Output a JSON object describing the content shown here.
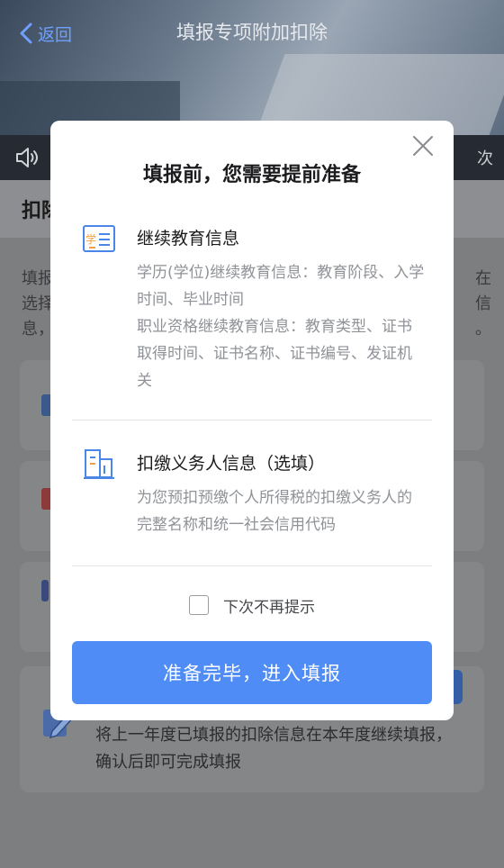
{
  "header": {
    "back_label": "返回",
    "title": "填报专项附加扣除"
  },
  "notice": {
    "tail_text": "次"
  },
  "background": {
    "section_head": "扣除",
    "desc_left_lines": [
      "填报",
      "选择",
      "息，"
    ],
    "desc_right_lines": [
      "在",
      "信",
      "。"
    ],
    "bottom_text": "将上一年度已填报的扣除信息在本年度继续填报，确认后即可完成填报"
  },
  "dialog": {
    "title": "填报前，您需要提前准备",
    "sections": [
      {
        "icon": "education-certificate-icon",
        "icon_text": "学",
        "title": "继续教育信息",
        "text": "学历(学位)继续教育信息：教育阶段、入学时间、毕业时间\n职业资格继续教育信息：教育类型、证书取得时间、证书名称、证书编号、发证机关"
      },
      {
        "icon": "building-icon",
        "title": "扣缴义务人信息（选填）",
        "text": "为您预扣预缴个人所得税的扣缴义务人的完整名称和统一社会信用代码"
      }
    ],
    "dont_show_label": "下次不再提示",
    "dont_show_checked": false,
    "confirm_label": "准备完毕，进入填报"
  },
  "colors": {
    "accent": "#4f8cf5",
    "back_link": "#6fa0ff",
    "icon_blue": "#4a86e8",
    "icon_orange": "#f0a040"
  }
}
